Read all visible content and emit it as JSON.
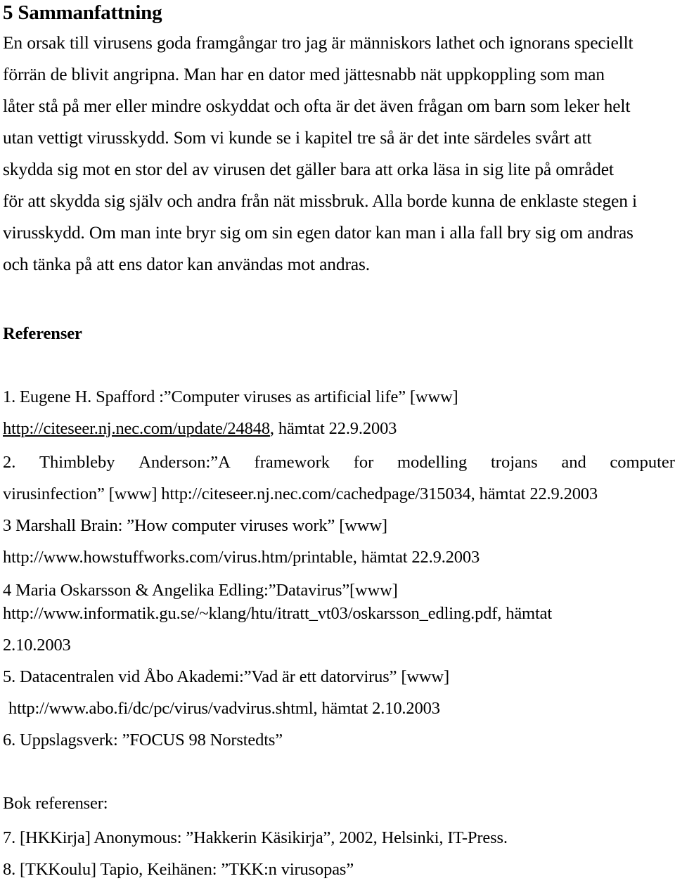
{
  "document": {
    "heading": "5 Sammanfattning",
    "summary_lines": [
      "En orsak till virusens goda framgångar tro jag är människors lathet och ignorans speciellt",
      "förrän de blivit angripna. Man har en dator med jättesnabb nät uppkoppling som man",
      "låter stå på mer eller mindre oskyddat och ofta är det även frågan om barn som leker helt",
      "utan vettigt virusskydd. Som vi kunde se i kapitel tre så är det inte särdeles svårt att",
      "skydda sig mot en stor del av virusen det gäller bara att orka läsa in sig lite på området",
      "för att skydda sig själv och andra från nät missbruk. Alla borde kunna de enklaste stegen i",
      "virusskydd. Om man inte bryr sig om sin egen dator kan man i alla fall bry sig om andras",
      "och tänka på att ens dator kan användas mot andras."
    ],
    "references_heading": "Referenser",
    "ref1_line1": "1.  Eugene H. Spafford :”Computer viruses as artificial life” [www]",
    "ref1_url": "http://citeseer.nj.nec.com/update/24848",
    "ref1_tail": ", hämtat 22.9.2003",
    "ref2_justified_words": [
      "2.",
      "Thimbleby",
      "Anderson:”A",
      "framework",
      "for",
      "modelling",
      "trojans",
      "and",
      "computer"
    ],
    "ref2_line2": "virusinfection” [www] http://citeseer.nj.nec.com/cachedpage/315034, hämtat 22.9.2003",
    "ref3_line1": "3 Marshall Brain: ”How computer viruses work” [www]",
    "ref3_line2": "http://www.howstuffworks.com/virus.htm/printable, hämtat 22.9.2003",
    "ref4_line1": "4 Maria Oskarsson & Angelika Edling:”Datavirus”[www]",
    "ref4_line2": "http://www.informatik.gu.se/~klang/htu/itratt_vt03/oskarsson_edling.pdf, hämtat",
    "ref4_line3": "2.10.2003",
    "ref5_line1": "5. Datacentralen vid Åbo Akademi:”Vad är ett datorvirus” [www]",
    "ref5_line2": "http://www.abo.fi/dc/pc/virus/vadvirus.shtml, hämtat 2.10.2003",
    "ref6_line1": "6. Uppslagsverk: ”FOCUS 98 Norstedts”",
    "book_references_heading": "Bok referenser:",
    "ref7_line1": "7. [HKKirja] Anonymous: ”Hakkerin Käsikirja”, 2002, Helsinki, IT-Press.",
    "ref8_line1": "8. [TKKoulu]  Tapio, Keihänen: ”TKK:n virusopas”"
  },
  "colors": {
    "text": "#000000",
    "background": "#ffffff"
  }
}
